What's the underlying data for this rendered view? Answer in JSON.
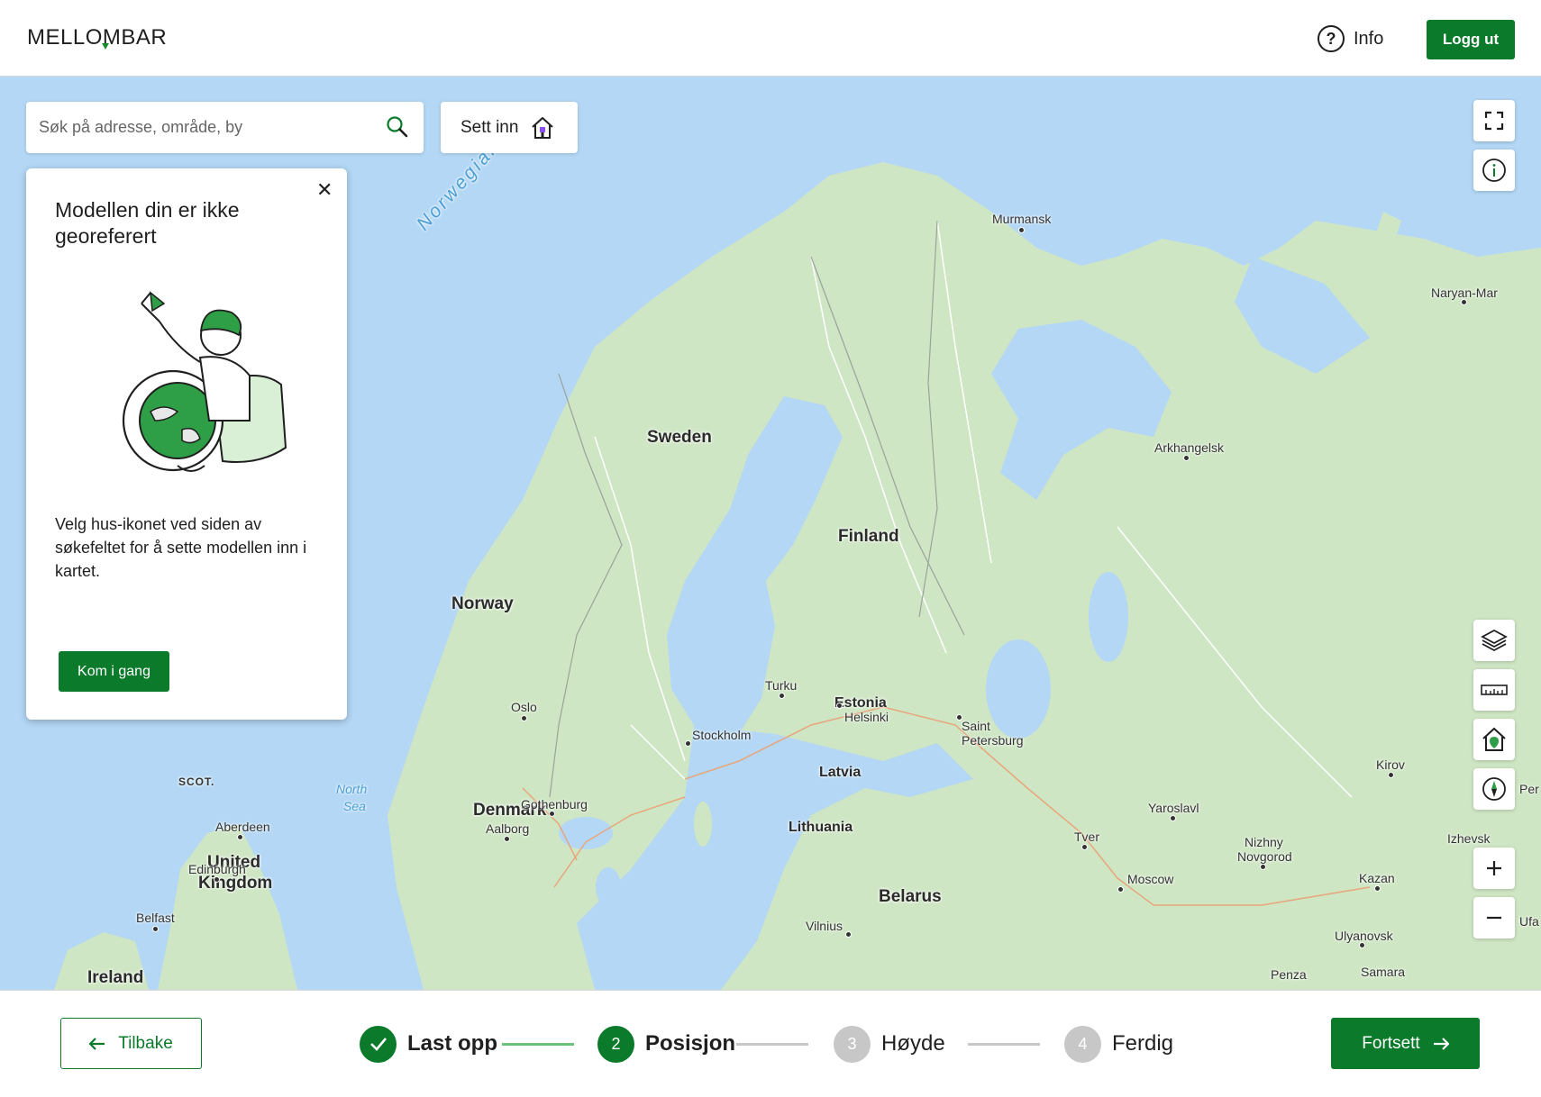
{
  "header": {
    "logo": "MELLOMBAR",
    "info_label": "Info",
    "logout_label": "Logg ut"
  },
  "search": {
    "placeholder": "Søk på adresse, område, by",
    "value": ""
  },
  "insert_button": {
    "label": "Sett inn"
  },
  "panel": {
    "title": "Modellen din er ikke georeferert",
    "body": "Velg hus-ikonet ved siden av søkefeltet for å sette modellen inn i kartet.",
    "cta_label": "Kom i gang",
    "close_symbol": "✕"
  },
  "map": {
    "countries": [
      "Sweden",
      "Finland",
      "Norway",
      "Estonia",
      "Latvia",
      "Denmark",
      "Lithuania",
      "Belarus",
      "United",
      "Kingdom",
      "Ireland"
    ],
    "regions": [
      "SCOT."
    ],
    "waters": [
      "Norwegian",
      "North",
      "Sea"
    ],
    "cities": [
      "Murmansk",
      "Naryan-Mar",
      "Arkhangelsk",
      "Turku",
      "Helsinki",
      "Oslo",
      "Stockholm",
      "Saint",
      "Petersburg",
      "Kirov",
      "Per",
      "Gothenburg",
      "Aalborg",
      "Aberdeen",
      "Edinburgh",
      "Belfast",
      "Yaroslavl",
      "Izhevsk",
      "Nizhny",
      "Novgorod",
      "Tver",
      "Moscow",
      "Kazan",
      "Vilnius",
      "Ulyanovsk",
      "Ufa",
      "Penza",
      "Samara"
    ],
    "controls": [
      "fullscreen-icon",
      "info-icon",
      "layers-icon",
      "ruler-icon",
      "home-location-icon",
      "compass-icon",
      "zoom-in-icon",
      "zoom-out-icon"
    ]
  },
  "footer": {
    "back_label": "Tilbake",
    "next_label": "Fortsett",
    "steps": [
      {
        "number": "",
        "label": "Last opp",
        "state": "done"
      },
      {
        "number": "2",
        "label": "Posisjon",
        "state": "active"
      },
      {
        "number": "3",
        "label": "Høyde",
        "state": "todo"
      },
      {
        "number": "4",
        "label": "Ferdig",
        "state": "todo"
      }
    ]
  },
  "colors": {
    "brand_green": "#0b7a2b",
    "water": "#b3d7f5",
    "land": "#cfe6c4",
    "step_inactive": "#c7c7c7"
  }
}
